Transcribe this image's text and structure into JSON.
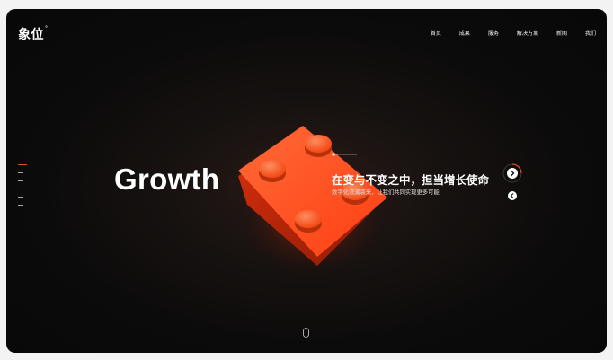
{
  "header": {
    "logo_text": "象位",
    "logo_mark": "°",
    "nav": [
      "首页",
      "成果",
      "服务",
      "解决方案",
      "新闻",
      "我们"
    ]
  },
  "hero": {
    "title": "Growth",
    "headline": "在变与不变之中，担当增长使命",
    "subline": "数字化浪潮袭来，让我们共同实现更多可能",
    "slide_count": 6,
    "active_slide": 1
  },
  "icons": {
    "next": "chevron-right-icon",
    "prev": "chevron-left-icon",
    "scroll": "mouse-scroll-icon",
    "product": "lego-brick-image"
  },
  "colors": {
    "accent": "#e54722",
    "brick": "#ff4a1c",
    "background": "#0b0b0b"
  }
}
